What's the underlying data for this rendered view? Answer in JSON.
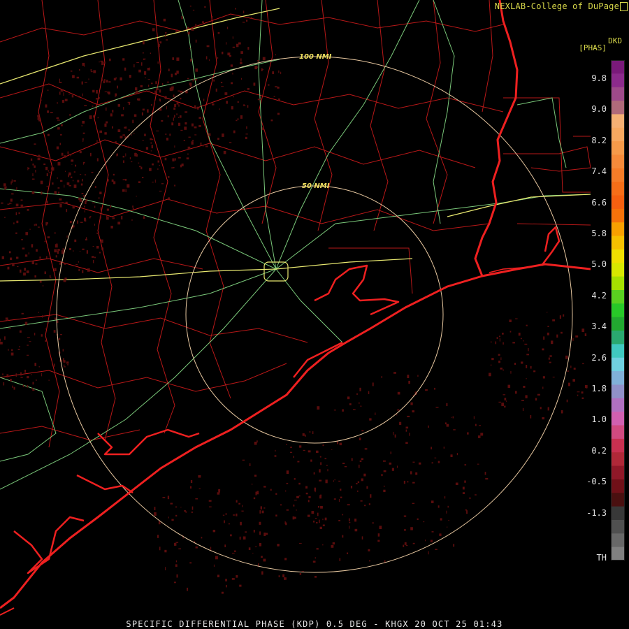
{
  "credit": "NEXLAB-College of DuPage",
  "product_code": "DKD",
  "units": "[PHAS]",
  "range_rings": [
    "100 NMI",
    "50 NMI"
  ],
  "color_scale": {
    "labels": [
      "9.8",
      "9.0",
      "8.2",
      "7.4",
      "6.6",
      "5.8",
      "5.0",
      "4.2",
      "3.4",
      "2.6",
      "1.8",
      "1.0",
      "0.2",
      "-0.5",
      "-1.3",
      "TH"
    ],
    "colors": [
      "#7a1a7a",
      "#8c2a8c",
      "#9e4a8a",
      "#b06a7a",
      "#f5b074",
      "#f7a860",
      "#f59a4a",
      "#f58a3a",
      "#f67c28",
      "#f66e18",
      "#f56010",
      "#f5720a",
      "#f8a000",
      "#f6c000",
      "#f0e000",
      "#d8e800",
      "#a6e000",
      "#5ad020",
      "#28c828",
      "#22a830",
      "#2aa870",
      "#40c8c0",
      "#70d0e0",
      "#80b0d8",
      "#9090c8",
      "#b070c0",
      "#d060b0",
      "#d04a80",
      "#c83050",
      "#b02838",
      "#901828",
      "#701018",
      "#4a1010",
      "#383838",
      "#505050",
      "#686868",
      "#808080"
    ],
    "colors_meaning": "bands from top (high) to bottom (TH)"
  },
  "footer": "SPECIFIC DIFFERENTIAL PHASE (KDP) 0.5 DEG - KHGX 20 OCT 25 01:43",
  "map_layers": [
    "county-borders",
    "highways",
    "coastline",
    "range-rings",
    "radar-returns"
  ]
}
